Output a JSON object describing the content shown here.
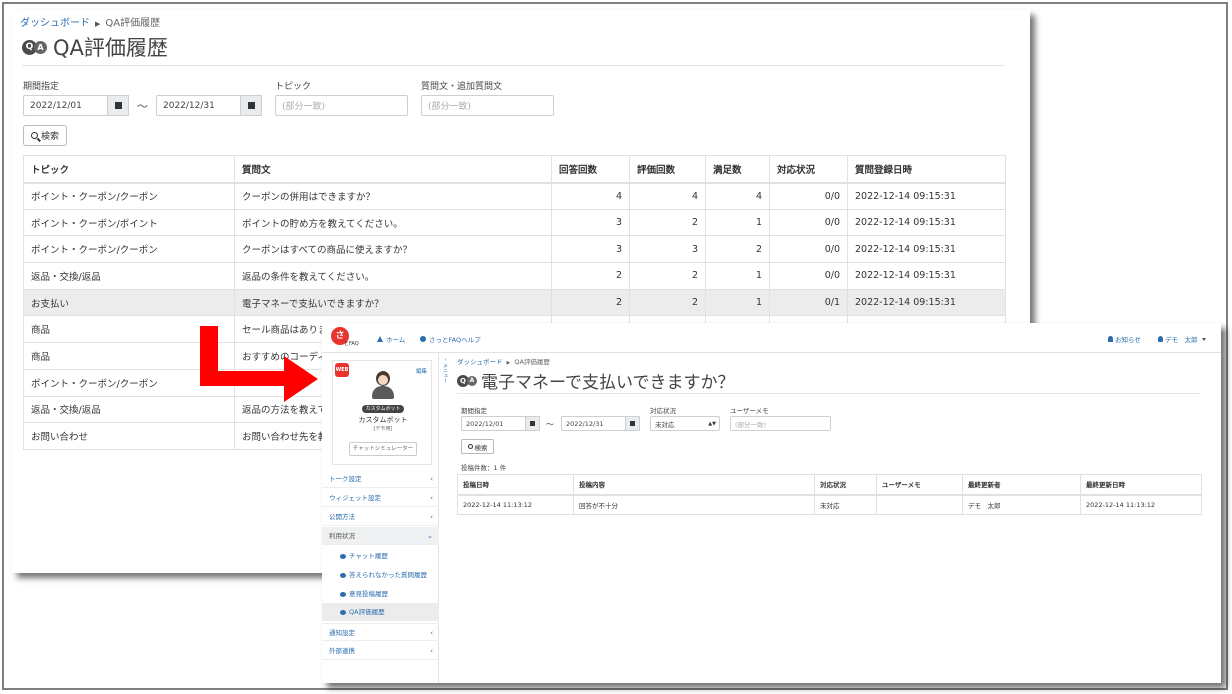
{
  "back_window": {
    "breadcrumb": {
      "home": "ダッシュボード",
      "current": "QA評価履歴"
    },
    "title": "QA評価履歴",
    "filters": {
      "period_label": "期間指定",
      "date_from": "2022/12/01",
      "date_to": "2022/12/31",
      "tilde": "～",
      "topic_label": "トピック",
      "topic_placeholder": "(部分一致)",
      "question_label": "質問文・追加質問文",
      "question_placeholder": "(部分一致)",
      "search_label": "検索"
    },
    "table": {
      "headers": [
        "トピック",
        "質問文",
        "回答回数",
        "評価回数",
        "満足数",
        "対応状況",
        "質問登録日時"
      ],
      "rows": [
        [
          "ポイント・クーポン/クーポン",
          "クーポンの併用はできますか？",
          "4",
          "4",
          "4",
          "0/0",
          "2022-12-14 09:15:31"
        ],
        [
          "ポイント・クーポン/ポイント",
          "ポイントの貯め方を教えてください。",
          "3",
          "2",
          "1",
          "0/0",
          "2022-12-14 09:15:31"
        ],
        [
          "ポイント・クーポン/クーポン",
          "クーポンはすべての商品に使えますか？",
          "3",
          "3",
          "2",
          "0/0",
          "2022-12-14 09:15:31"
        ],
        [
          "返品・交換/返品",
          "返品の条件を教えてください。",
          "2",
          "2",
          "1",
          "0/0",
          "2022-12-14 09:15:31"
        ],
        [
          "お支払い",
          "電子マネーで支払いできますか？",
          "2",
          "2",
          "1",
          "0/1",
          "2022-12-14 09:15:31"
        ],
        [
          "商品",
          "セール商品はありますか",
          "",
          "",
          "",
          "",
          ""
        ],
        [
          "商品",
          "おすすめのコーディネ",
          "",
          "",
          "",
          "",
          ""
        ],
        [
          "ポイント・クーポン/クーポン",
          "",
          "",
          "",
          "",
          "",
          ""
        ],
        [
          "返品・交換/返品",
          "返品の方法を教えてく",
          "",
          "",
          "",
          "",
          ""
        ],
        [
          "お問い合わせ",
          "お問い合わせ先を教え",
          "",
          "",
          "",
          "",
          ""
        ]
      ]
    }
  },
  "front_window": {
    "logo": {
      "mark": "さ",
      "sub": "とFAQ"
    },
    "nav": {
      "home": "ホーム",
      "help": "さっとFAQヘルプ",
      "notify": "お知らせ",
      "user": "デモ　太郎"
    },
    "bot": {
      "logo": "WEB",
      "edit": "編集",
      "badge": "カスタムボット",
      "name": "カスタムボット",
      "sub": "[デモ用]",
      "sim_button": "チャットシミュレーター"
    },
    "collapse_tab": "メニュー",
    "menu": [
      {
        "label": "トーク設定",
        "chev": "‹"
      },
      {
        "label": "ウィジェット設定",
        "chev": "‹"
      },
      {
        "label": "公開方法",
        "chev": "‹"
      },
      {
        "label": "利用状況",
        "chev": "⌄"
      }
    ],
    "submenu": [
      "チャット履歴",
      "答えられなかった質問履歴",
      "意見投稿履歴",
      "QA評価履歴"
    ],
    "menu_after": [
      {
        "label": "通知設定",
        "chev": "‹"
      },
      {
        "label": "外部連携",
        "chev": "‹"
      }
    ],
    "breadcrumb": {
      "home": "ダッシュボード",
      "current": "QA評価履歴"
    },
    "title": "電子マネーで支払いできますか？",
    "filters": {
      "period_label": "期間指定",
      "date_from": "2022/12/01",
      "date_to": "2022/12/31",
      "tilde": "～",
      "status_label": "対応状況",
      "status_value": "未対応",
      "memo_label": "ユーザーメモ",
      "memo_placeholder": "(部分一致)",
      "search_label": "検索"
    },
    "count_text": "投稿件数：1 件",
    "table": {
      "headers": [
        "投稿日時",
        "投稿内容",
        "対応状況",
        "ユーザーメモ",
        "最終更新者",
        "最終更新日時"
      ],
      "rows": [
        [
          "2022-12-14 11:13:12",
          "回答が不十分",
          "未対応",
          "",
          "デモ　太郎",
          "2022-12-14 11:13:12"
        ]
      ]
    }
  },
  "colors": {
    "arrow": "#ff0000",
    "link": "#2a6db0",
    "brand": "#e8332e",
    "highlight_row": "#ececec"
  }
}
